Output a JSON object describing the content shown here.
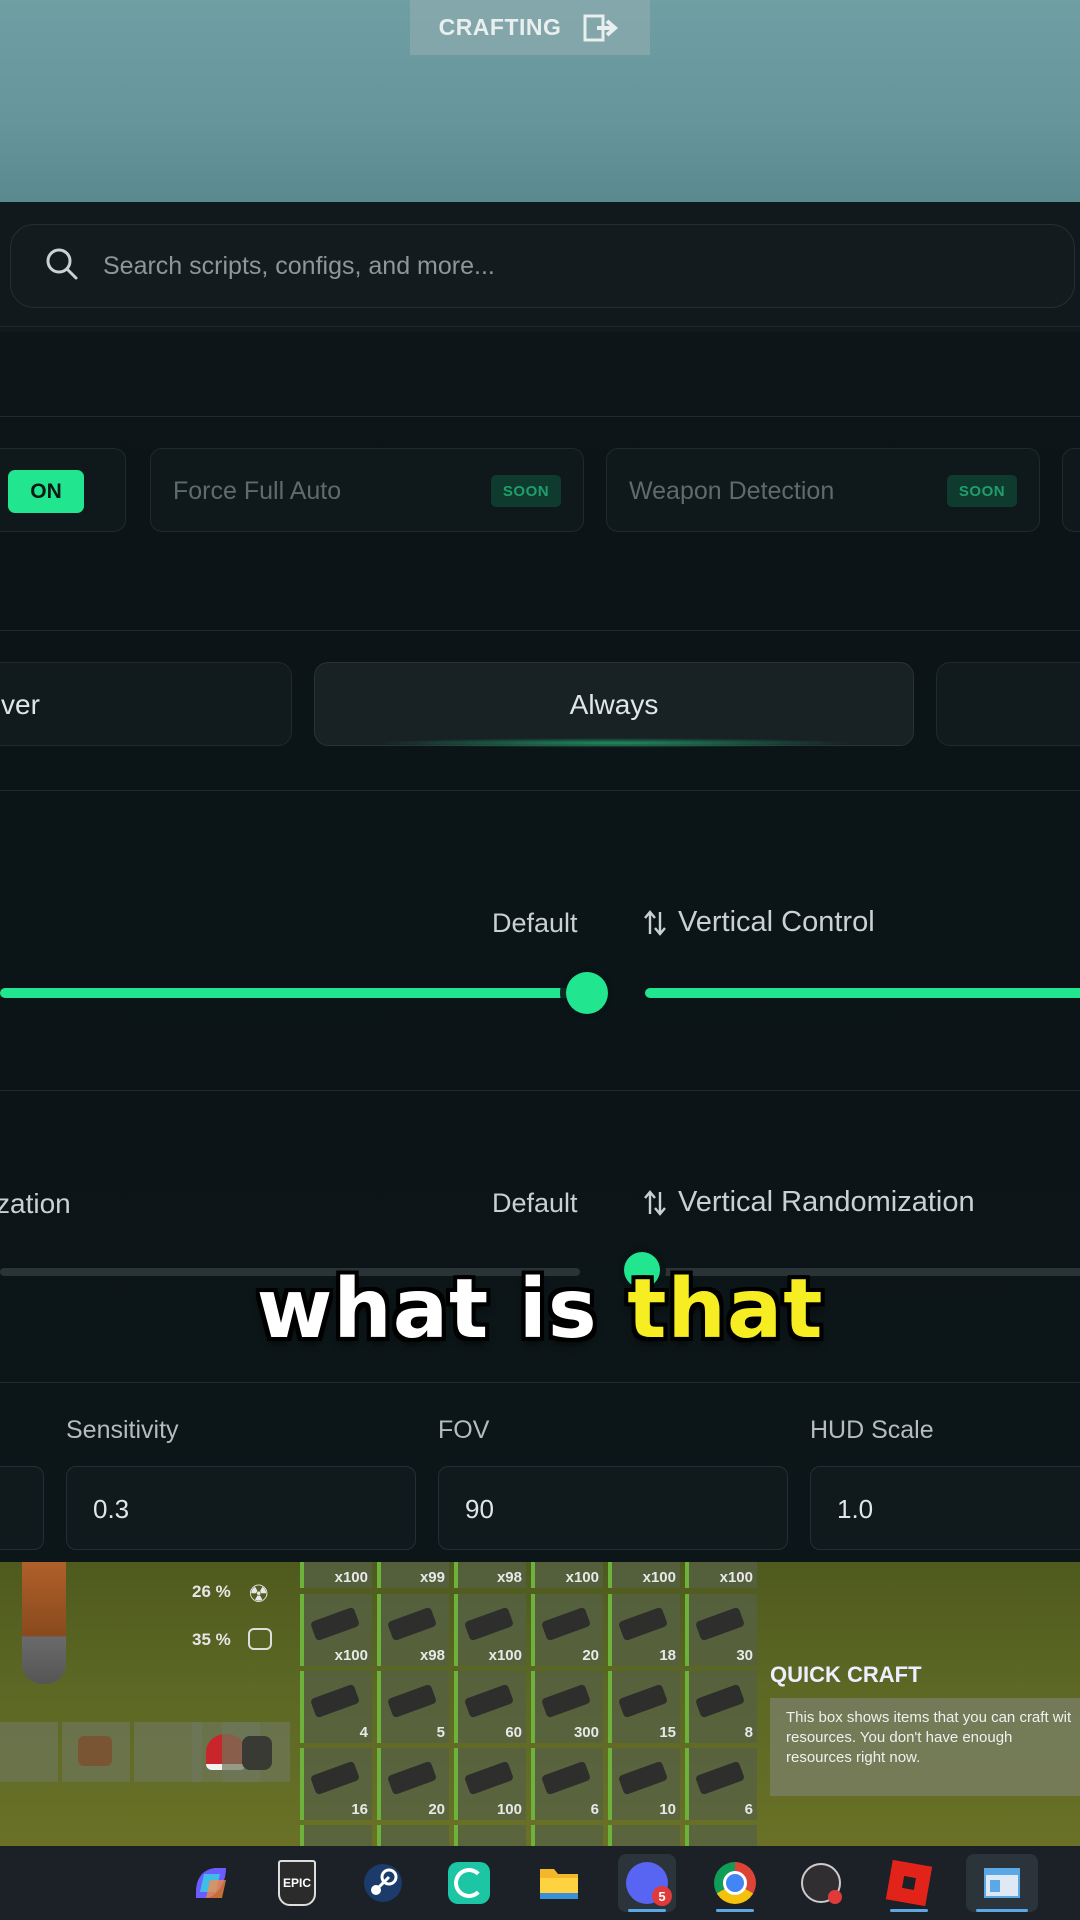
{
  "game_top": {
    "crafting_label": "CRAFTING",
    "exit_icon": "exit-icon"
  },
  "search": {
    "placeholder": "Search scripts, configs, and more..."
  },
  "toggles": {
    "on_label": "ON",
    "force_full_auto": {
      "label": "Force Full Auto",
      "badge": "SOON"
    },
    "weapon_detection": {
      "label": "Weapon Detection",
      "badge": "SOON"
    }
  },
  "modes": {
    "left_partial": "ver",
    "selected": "Always"
  },
  "control": {
    "default_label": "Default",
    "vertical_label": "Vertical Control",
    "left_slider_value_fraction": 1.0
  },
  "randomization": {
    "left_partial": "zation",
    "default_label": "Default",
    "vertical_label": "Vertical Randomization"
  },
  "fields": {
    "sensitivity": {
      "label": "Sensitivity",
      "value": "0.3"
    },
    "fov": {
      "label": "FOV",
      "value": "90"
    },
    "hud_scale": {
      "label": "HUD Scale",
      "value": "1.0"
    }
  },
  "caption": {
    "part1": "what is ",
    "part2": "that"
  },
  "inventory": {
    "stats": [
      "26 %",
      "35 %"
    ],
    "top_row_counts": [
      "x100",
      "x99",
      "x98",
      "x100",
      "x100",
      "x100"
    ],
    "rows": [
      [
        "x100",
        "x98",
        "x100",
        "20",
        "18",
        "30"
      ],
      [
        "4",
        "5",
        "60",
        "300",
        "15",
        "8"
      ],
      [
        "16",
        "20",
        "100",
        "6",
        "10",
        "6"
      ]
    ],
    "quick_craft_title": "QUICK CRAFT",
    "quick_craft_text": "This box shows items that you can craft wit resources. You don't have enough resources right now."
  },
  "taskbar": {
    "icons": [
      "copilot-icon",
      "epic-games-icon",
      "steam-icon",
      "app-icon",
      "file-explorer-icon",
      "discord-icon",
      "chrome-icon",
      "obs-icon",
      "roblox-icon",
      "window-icon"
    ],
    "discord_badge": "5",
    "epic_label": "EPIC"
  },
  "colors": {
    "accent": "#22e58f",
    "caption_highlight": "#f6ee22",
    "panel_bg": "#0c1517"
  }
}
